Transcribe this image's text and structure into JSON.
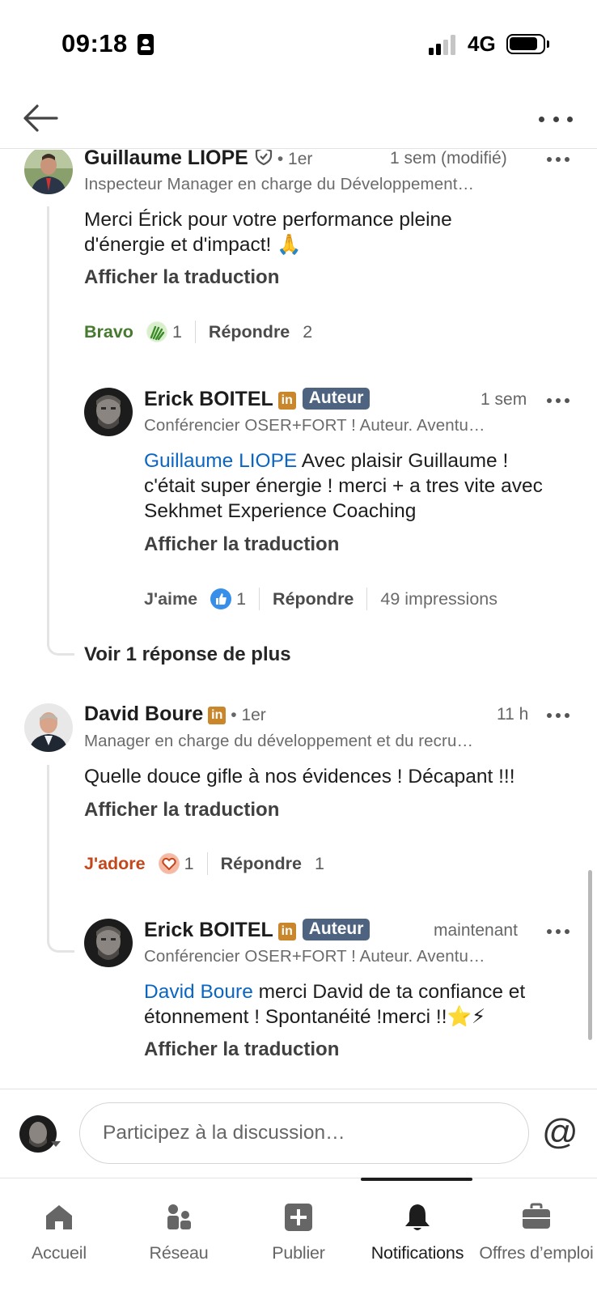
{
  "status_bar": {
    "time": "09:18",
    "network": "4G"
  },
  "comments": [
    {
      "author": "Guillaume LIOPE",
      "degree": "• 1er",
      "time": "1 sem (modifié)",
      "headline": "Inspecteur Manager en charge du Développement…",
      "text": "Merci Érick pour votre performance pleine d'énergie et d'impact! 🙏",
      "translate": "Afficher la traduction",
      "reaction_label": "Bravo",
      "reaction_count": "1",
      "reply_label": "Répondre",
      "reply_count": "2",
      "reply": {
        "author": "Erick BOITEL",
        "badge": "Auteur",
        "time": "1 sem",
        "headline": "Conférencier OSER+FORT ! Auteur. Aventu…",
        "mention": "Guillaume LIOPE",
        "text": " Avec plaisir Guillaume ! c'était super énergie ! merci + a tres vite avec Sekhmet Experience Coaching",
        "translate": "Afficher la traduction",
        "reaction_label": "J'aime",
        "reaction_count": "1",
        "reply_label": "Répondre",
        "impressions": "49 impressions"
      },
      "see_more": "Voir 1 réponse de plus"
    },
    {
      "author": "David Boure",
      "degree": "• 1er",
      "time": "11 h",
      "headline": "Manager en charge du développement et du recru…",
      "text": "Quelle douce gifle à nos évidences ! Décapant !!!",
      "translate": "Afficher la traduction",
      "reaction_label": "J'adore",
      "reaction_count": "1",
      "reply_label": "Répondre",
      "reply_count": "1",
      "reply": {
        "author": "Erick BOITEL",
        "badge": "Auteur",
        "time": "maintenant",
        "headline": "Conférencier OSER+FORT ! Auteur. Aventu…",
        "mention": "David Boure",
        "text": " merci David de ta confiance et étonnement ! Spontanéité !merci !!⭐⚡",
        "translate": "Afficher la traduction"
      }
    }
  ],
  "composer": {
    "placeholder": "Participez à la discussion…",
    "at_symbol": "@"
  },
  "bottom_nav": [
    {
      "label": "Accueil",
      "icon": "home-icon"
    },
    {
      "label": "Réseau",
      "icon": "network-icon"
    },
    {
      "label": "Publier",
      "icon": "post-icon"
    },
    {
      "label": "Notifications",
      "icon": "bell-icon",
      "active": true
    },
    {
      "label": "Offres d’emploi",
      "icon": "briefcase-icon"
    }
  ],
  "colors": {
    "link": "#0a66c2",
    "bravo": "#467a2e",
    "jadore": "#c4471c",
    "auteur_badge": "#4d6380",
    "linkedin_badge": "#c9862b"
  }
}
